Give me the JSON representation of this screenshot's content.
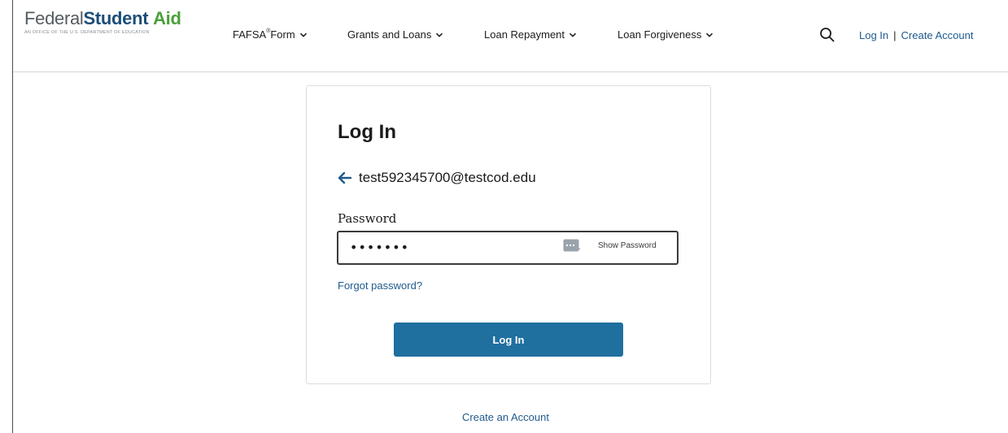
{
  "logo": {
    "federal": "Federal",
    "student": "Student",
    "aid": "Aid",
    "tagline": "An OFFICE of the U.S. DEPARTMENT of EDUCATION"
  },
  "nav": {
    "items": [
      {
        "label": "FAFSA",
        "sup": "®",
        "suffix": " Form"
      },
      {
        "label": "Grants and Loans"
      },
      {
        "label": "Loan Repayment"
      },
      {
        "label": "Loan Forgiveness"
      }
    ],
    "search_icon": "search-icon",
    "login_label": "Log In",
    "separator": "|",
    "create_label": "Create Account"
  },
  "login_card": {
    "title": "Log In",
    "email": "test592345700@testcod.edu",
    "password_label": "Password",
    "password_value": "•••••••",
    "show_password_label": "Show Password",
    "forgot_label": "Forgot password?",
    "submit_label": "Log In"
  },
  "footer": {
    "create_account_label": "Create an Account"
  },
  "colors": {
    "brand_blue": "#1c4e78",
    "brand_green": "#4aa03a",
    "link": "#1f5a8c",
    "button": "#1f6f9f"
  }
}
